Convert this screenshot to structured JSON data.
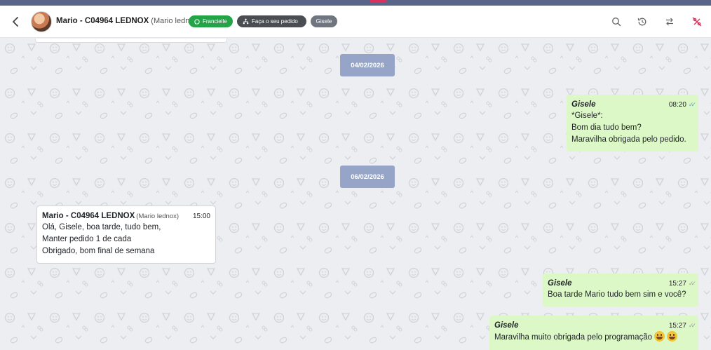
{
  "header": {
    "contact_name": "Mario - C04964 LEDNOX",
    "contact_sub": "(Mario lednox)",
    "tags": {
      "agent_label": "Francielle",
      "menu_label": "Faça o seu pedido",
      "user_label": "Gisele"
    },
    "icons": [
      "back-arrow-icon",
      "whatsapp-icon",
      "flow-icon",
      "search-icon",
      "history-icon",
      "transfer-icon",
      "percent-off-icon"
    ]
  },
  "chat": {
    "date_1": "04/02/2026",
    "date_2": "06/02/2026",
    "messages": [
      {
        "direction": "out",
        "sender": "Gisele",
        "time": "08:20",
        "status": "read",
        "lines": [
          "*Gisele*:",
          "Bom dia tudo bem?",
          "Maravilha obrigada pelo pedido."
        ]
      },
      {
        "direction": "in",
        "sender": "Mario - C04964 LEDNOX",
        "sender_sub": "(Mario lednox)",
        "time": "15:00",
        "lines": [
          "Olá, Gisele, boa tarde, tudo bem,",
          "Manter pedido 1 de cada",
          "Obrigado, bom final de semana"
        ]
      },
      {
        "direction": "out",
        "sender": "Gisele",
        "time": "15:27",
        "status": "delivered",
        "lines": [
          "Boa tarde Mario tudo bem sim e você?"
        ]
      },
      {
        "direction": "out",
        "sender": "Gisele",
        "time": "15:27",
        "status": "delivered",
        "lines": [
          "Maravilha muito obrigada pelo programação"
        ],
        "emojis": [
          "grinning-face-emoji",
          "grinning-face-emoji"
        ]
      }
    ]
  },
  "colors": {
    "header_strip": "#59668a",
    "outgoing_bubble": "#dcf8c6",
    "incoming_bubble": "#ffffff",
    "date_chip": "#96a5c7",
    "tag_green": "#22a447",
    "tag_dark": "#4a4d52",
    "tag_gray": "#6f7680",
    "read_tick": "#5aa6e8",
    "percent_icon": "#d8315b"
  }
}
